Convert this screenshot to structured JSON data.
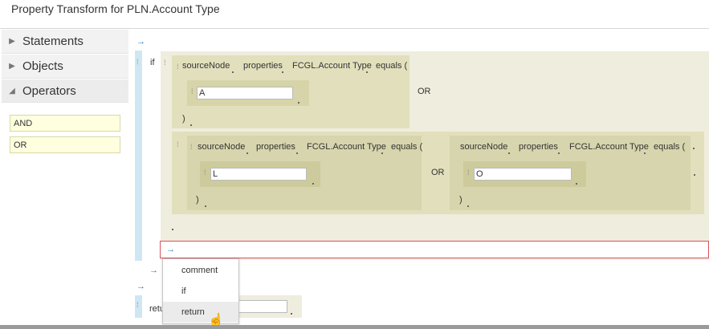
{
  "title": "Property Transform for PLN.Account Type",
  "panel": {
    "sections": [
      {
        "label": "Statements",
        "expanded": false
      },
      {
        "label": "Objects",
        "expanded": false
      },
      {
        "label": "Operators",
        "expanded": true
      }
    ],
    "operators": [
      "AND",
      "OR"
    ]
  },
  "canvas": {
    "if_keyword": "if",
    "or_label": "OR",
    "cond1": {
      "node": "sourceNode",
      "prop": "properties",
      "field": "FCGL.Account Type",
      "op": "equals (",
      "value": "A",
      "close": ")"
    },
    "cond2": {
      "node": "sourceNode",
      "prop": "properties",
      "field": "FCGL.Account Type",
      "op": "equals (",
      "value": "L",
      "close": ")"
    },
    "cond3": {
      "node": "sourceNode",
      "prop": "properties",
      "field": "FCGL.Account Type",
      "op": "equals (",
      "value": "O",
      "close": ")"
    },
    "return_partial": "retu"
  },
  "menu": {
    "items": [
      "comment",
      "if",
      "return"
    ],
    "hovered": "return"
  },
  "colors": {
    "accent_blue": "#2a7ac4",
    "block": "#eeecdc",
    "nested": "#e0deba",
    "operator_bg": "#ffffe0",
    "error_border": "#e0505a"
  }
}
